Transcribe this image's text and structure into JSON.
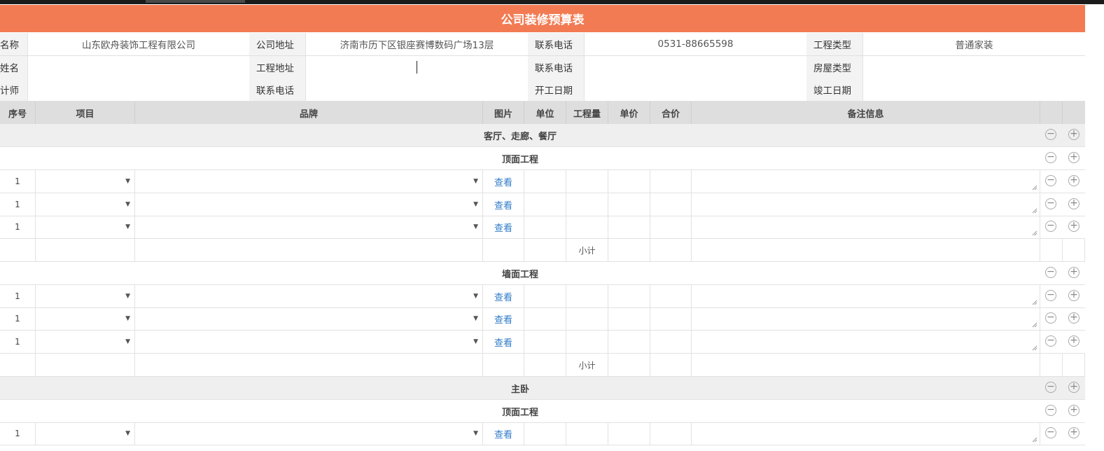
{
  "title": "公司装修预算表",
  "info": [
    {
      "l1": "名称",
      "v1": "山东欧舟装饰工程有限公司",
      "l2": "公司地址",
      "v2": "济南市历下区银座赛博数码广场13层",
      "l3": "联系电话",
      "v3": "0531-88665598",
      "l4": "工程类型",
      "v4": "普通家装"
    },
    {
      "l1": "姓名",
      "v1": "",
      "l2": "工程地址",
      "v2": "",
      "l3": "联系电话",
      "v3": "",
      "l4": "房屋类型",
      "v4": ""
    },
    {
      "l1": "计师",
      "v1": "",
      "l2": "联系电话",
      "v2": "",
      "l3": "开工日期",
      "v3": "",
      "l4": "竣工日期",
      "v4": ""
    }
  ],
  "columns": [
    "序号",
    "项目",
    "品牌",
    "图片",
    "单位",
    "工程量",
    "单价",
    "合价",
    "备注信息"
  ],
  "link_label": "查看",
  "subtotal_label": "小计",
  "groups": [
    "客厅、走廊、餐厅",
    "主卧"
  ],
  "sections": [
    "顶面工程",
    "墙面工程",
    "顶面工程"
  ],
  "row_index": "1",
  "icons": {
    "dropdown": "dropdown-arrow-icon",
    "remove": "minus-circle-icon",
    "add": "plus-circle-icon"
  },
  "colors": {
    "header": "#f37b53",
    "link": "#2f7bc8"
  }
}
